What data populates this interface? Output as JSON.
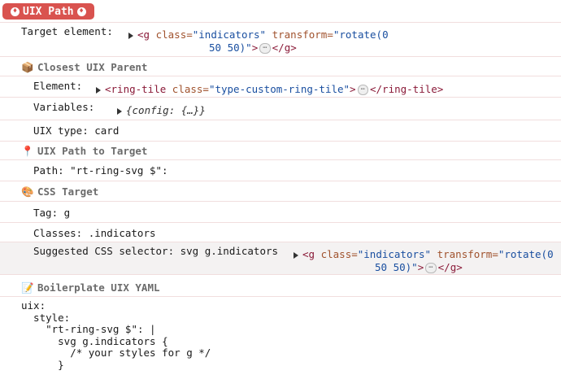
{
  "banner": {
    "title": "UIX Path"
  },
  "target_element": {
    "label": "Target element:",
    "tag_open": "<g",
    "attr_class": "class=",
    "class_value": "\"indicators\"",
    "attr_transform": "transform=",
    "transform_value_1": "\"rotate(0",
    "transform_value_2": "50 50)\"",
    "gt": ">",
    "tag_close": "</g>"
  },
  "closest_parent": {
    "title": "Closest UIX Parent",
    "element_label": "Element:",
    "element_open": "<ring-tile",
    "element_class_attr": "class=",
    "element_class_value": "\"type-custom-ring-tile\"",
    "element_gt": ">",
    "element_close": "</ring-tile>",
    "variables_label": "Variables:",
    "variables_key": "config",
    "variables_value": "{…}",
    "uix_type_label": "UIX type: card"
  },
  "path_to_target": {
    "title": "UIX Path to Target",
    "path_label": "Path: \"rt-ring-svg $\":"
  },
  "css_target": {
    "title": "CSS Target",
    "tag_label": "Tag: g",
    "classes_label": "Classes: .indicators",
    "selector_label": "Suggested CSS selector: svg g.indicators",
    "sel_tag_open": "<g",
    "sel_attr_class": "class=",
    "sel_class_value": "\"indicators\"",
    "sel_attr_transform": "transform=",
    "sel_transform_value_1": "\"rotate(0",
    "sel_transform_value_2": "50 50)\"",
    "sel_gt": ">",
    "sel_tag_close": "</g>"
  },
  "boilerplate": {
    "title": "Boilerplate UIX YAML",
    "yaml": "uix:\n  style:\n    \"rt-ring-svg $\": |\n      svg g.indicators {\n        /* your styles for g */\n      }"
  },
  "colors": {
    "banner": "#d9534f",
    "tag": "#8a1a38",
    "attr": "#a0522d",
    "value": "#1a4fa0",
    "divider": "#f1dede"
  },
  "icons": {
    "banner": "lightbulb-icon",
    "parent": "package-icon",
    "path": "pushpin-icon",
    "css": "palette-icon",
    "yaml": "memo-icon"
  }
}
